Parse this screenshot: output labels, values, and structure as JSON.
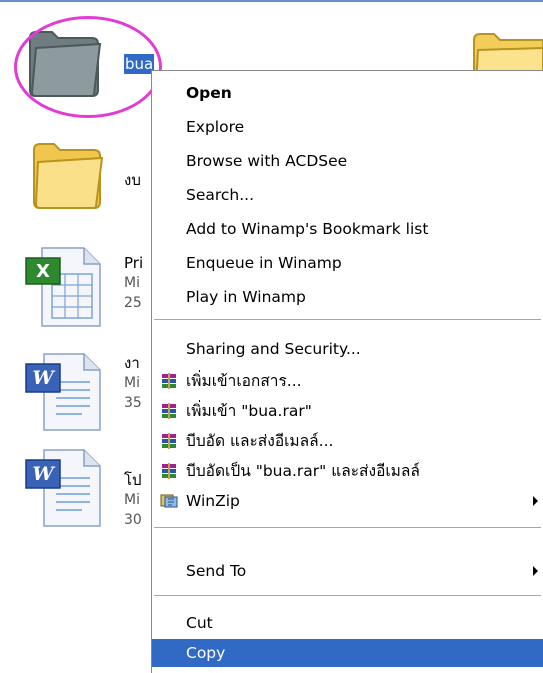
{
  "explorer": {
    "folder_selected": {
      "name": "bua"
    },
    "folder_right": {
      "name": ""
    },
    "folder_2": {
      "name": "งบ"
    },
    "file_1": {
      "name": "Pri",
      "type": "Mi",
      "size": "25"
    },
    "file_2": {
      "name": "งา",
      "type": "Mi",
      "size": "35"
    },
    "file_3": {
      "name": "โป",
      "type": "Mi",
      "size": "30"
    }
  },
  "context_menu": {
    "items": [
      {
        "label": "Open"
      },
      {
        "label": "Explore"
      },
      {
        "label": "Browse with ACDSee"
      },
      {
        "label": "Search..."
      },
      {
        "label": "Add to Winamp's Bookmark list"
      },
      {
        "label": "Enqueue in Winamp"
      },
      {
        "label": "Play in Winamp"
      },
      {
        "label": "Sharing and Security..."
      },
      {
        "label": "เพิ่มเข้าเอกสาร..."
      },
      {
        "label": "เพิ่มเข้า \"bua.rar\""
      },
      {
        "label": "บีบอัด และส่งอีเมลล์..."
      },
      {
        "label": "บีบอัดเป็น \"bua.rar\" และส่งอีเมลล์"
      },
      {
        "label": "WinZip"
      },
      {
        "label": "Send To"
      },
      {
        "label": "Cut"
      },
      {
        "label": "Copy"
      }
    ]
  },
  "colors": {
    "selection": "#316ac5",
    "highlight_ring": "#e23bd6",
    "folder_yellow": "#f6d56a",
    "folder_gray": "#7f8c8f"
  }
}
